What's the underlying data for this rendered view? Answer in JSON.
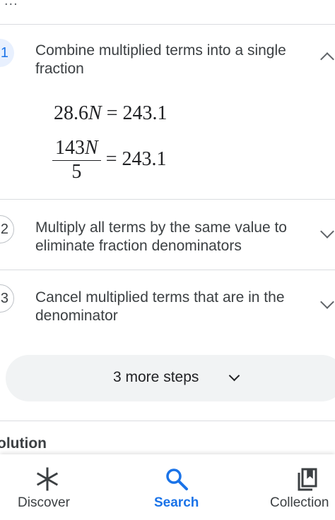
{
  "top_partial_text": "...",
  "steps": [
    {
      "number": "1",
      "title": "Combine multiplied terms into a single fraction",
      "expanded": true,
      "math": {
        "line1": {
          "coef": "28.6",
          "var": "N",
          "eq": "=",
          "rhs": "243.1"
        },
        "line2": {
          "num_coef": "143",
          "num_var": "N",
          "den": "5",
          "eq": "=",
          "rhs": "243.1"
        }
      }
    },
    {
      "number": "2",
      "title": "Multiply all terms by the same value to eliminate fraction denominators",
      "expanded": false
    },
    {
      "number": "3",
      "title": "Cancel multiplied terms that are in the denominator",
      "expanded": false
    }
  ],
  "more_steps_label": "3 more steps",
  "solution_heading": "olution",
  "bottom_nav": {
    "items": [
      {
        "label": "Discover",
        "icon": "asterisk-icon",
        "active": false
      },
      {
        "label": "Search",
        "icon": "search-icon",
        "active": true
      },
      {
        "label": "Collection",
        "icon": "collections-bookmark-icon",
        "active": false
      }
    ]
  },
  "colors": {
    "accent": "#1a73e8",
    "active_step_bg": "#e8f0fe",
    "divider": "#dadce0",
    "pill_bg": "#f1f3f4",
    "text_primary": "#202124",
    "text_secondary": "#3c4043",
    "nav_inactive": "#3c4043"
  }
}
